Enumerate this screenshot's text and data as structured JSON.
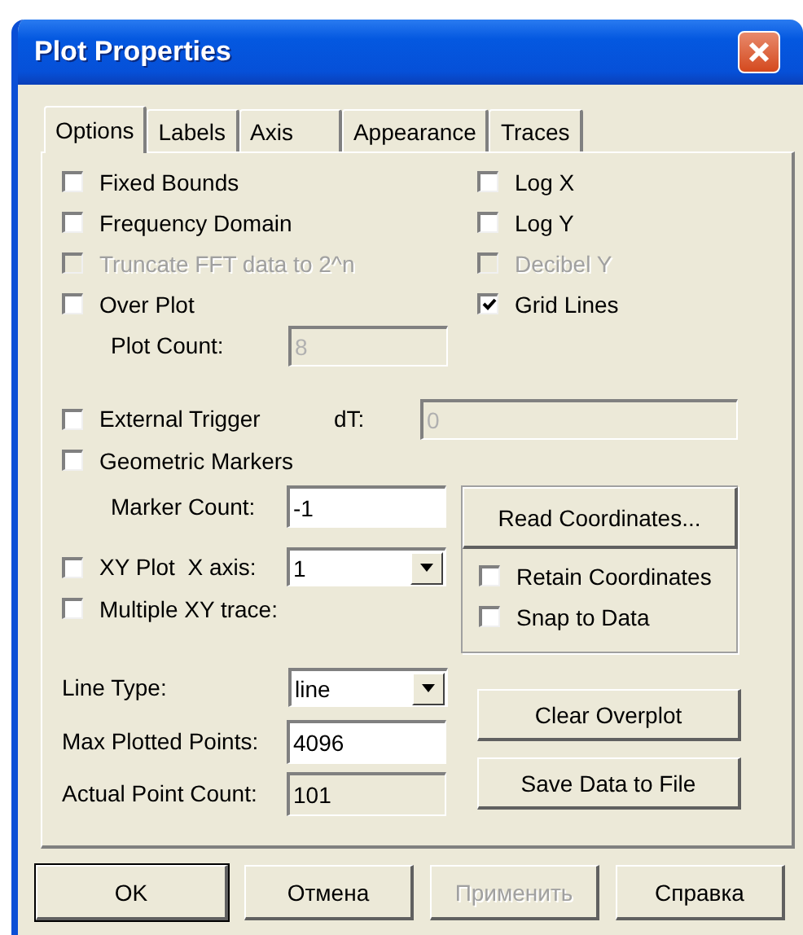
{
  "window": {
    "title": "Plot Properties"
  },
  "tabs": [
    {
      "label": "Options",
      "selected": true
    },
    {
      "label": "Labels",
      "selected": false
    },
    {
      "label": "Axis",
      "selected": false
    },
    {
      "label": "Appearance",
      "selected": false
    },
    {
      "label": "Traces",
      "selected": false
    }
  ],
  "top_checks": [
    {
      "label": "Fixed Bounds",
      "checked": false,
      "disabled": false
    },
    {
      "label": "Log X",
      "checked": false,
      "disabled": false
    },
    {
      "label": "Frequency Domain",
      "checked": false,
      "disabled": false
    },
    {
      "label": "Log Y",
      "checked": false,
      "disabled": false
    },
    {
      "label": "Truncate FFT data to 2^n",
      "checked": false,
      "disabled": true
    },
    {
      "label": "Decibel Y",
      "checked": false,
      "disabled": true
    },
    {
      "label": "Over Plot",
      "checked": false,
      "disabled": false
    },
    {
      "label": "Grid Lines",
      "checked": true,
      "disabled": false
    }
  ],
  "plot_count": {
    "label": "Plot Count:",
    "value": "8",
    "disabled": true
  },
  "external_trigger": {
    "label": "External Trigger",
    "checked": false,
    "disabled": false
  },
  "dt": {
    "label": "dT:",
    "value": "0",
    "disabled": true
  },
  "geometric_markers": {
    "label": "Geometric Markers",
    "checked": false,
    "disabled": false
  },
  "marker_count": {
    "label": "Marker Count:",
    "value": "-1",
    "disabled": false
  },
  "xy_plot": {
    "label": "XY Plot  X axis:",
    "checked": false,
    "disabled": false
  },
  "x_axis": {
    "value": "1"
  },
  "multiple_xy": {
    "label": "Multiple XY trace:",
    "checked": false,
    "disabled": false
  },
  "coordinates": {
    "button": "Read Coordinates...",
    "checks": [
      {
        "label": "Retain Coordinates",
        "checked": false,
        "disabled": false
      },
      {
        "label": "Snap to Data",
        "checked": false,
        "disabled": false
      }
    ]
  },
  "line_type": {
    "label": "Line Type:",
    "value": "line"
  },
  "max_points": {
    "label": "Max Plotted Points:",
    "value": "4096",
    "disabled": false
  },
  "actual_count": {
    "label": "Actual Point Count:",
    "value": "101",
    "disabled": true
  },
  "side_buttons": [
    "Clear Overplot",
    "Save Data to File"
  ],
  "footer_buttons": [
    {
      "label": "OK",
      "default": true,
      "disabled": false
    },
    {
      "label": "Отмена",
      "default": false,
      "disabled": false
    },
    {
      "label": "Применить",
      "default": false,
      "disabled": true
    },
    {
      "label": "Справка",
      "default": false,
      "disabled": false
    }
  ]
}
